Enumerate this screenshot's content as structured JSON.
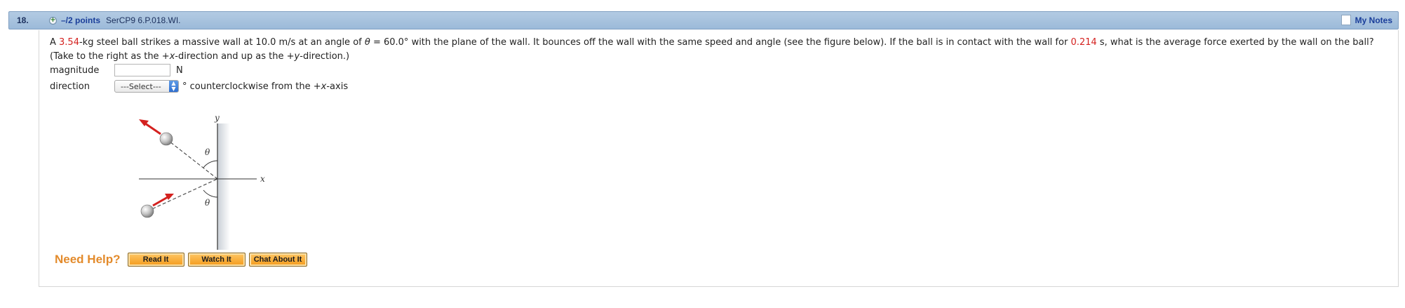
{
  "header": {
    "question_number": "18.",
    "plus_icon": "plus-circle-icon",
    "points": "–/2 points",
    "question_id": "SerCP9 6.P.018.WI.",
    "my_notes": "My Notes"
  },
  "question": {
    "part1": "A ",
    "mass": "3.54",
    "part2": "-kg steel ball strikes a massive wall at 10.0 m/s at an angle of ",
    "theta": "θ",
    "part3": " = 60.0° with the plane of the wall. It bounces off the wall with the same speed and angle (see the figure below). If the ball is in contact with the wall for ",
    "time": "0.214",
    "part4": " s, what is the average force exerted by the wall on the ball? (Take to the right as the +",
    "x1": "x",
    "part5": "-direction and up as the +",
    "y1": "y",
    "part6": "-direction.)"
  },
  "answers": {
    "magnitude_label": "magnitude",
    "magnitude_value": "",
    "magnitude_unit": "N",
    "direction_label": "direction",
    "direction_select": "---Select---",
    "direction_suffix_a": "° counterclockwise from the +",
    "direction_suffix_x": "x",
    "direction_suffix_b": "-axis"
  },
  "figure": {
    "y_label": "y",
    "x_label": "x",
    "theta_top": "θ",
    "theta_bottom": "θ"
  },
  "help": {
    "label": "Need Help?",
    "buttons": [
      "Read It",
      "Watch It",
      "Chat About It"
    ]
  },
  "colors": {
    "header_bg": "#9cbad9",
    "accent_red": "#d4211f",
    "help_orange": "#e38b2c",
    "button_orange": "#f39a1b",
    "link_blue": "#1a3e9a"
  }
}
